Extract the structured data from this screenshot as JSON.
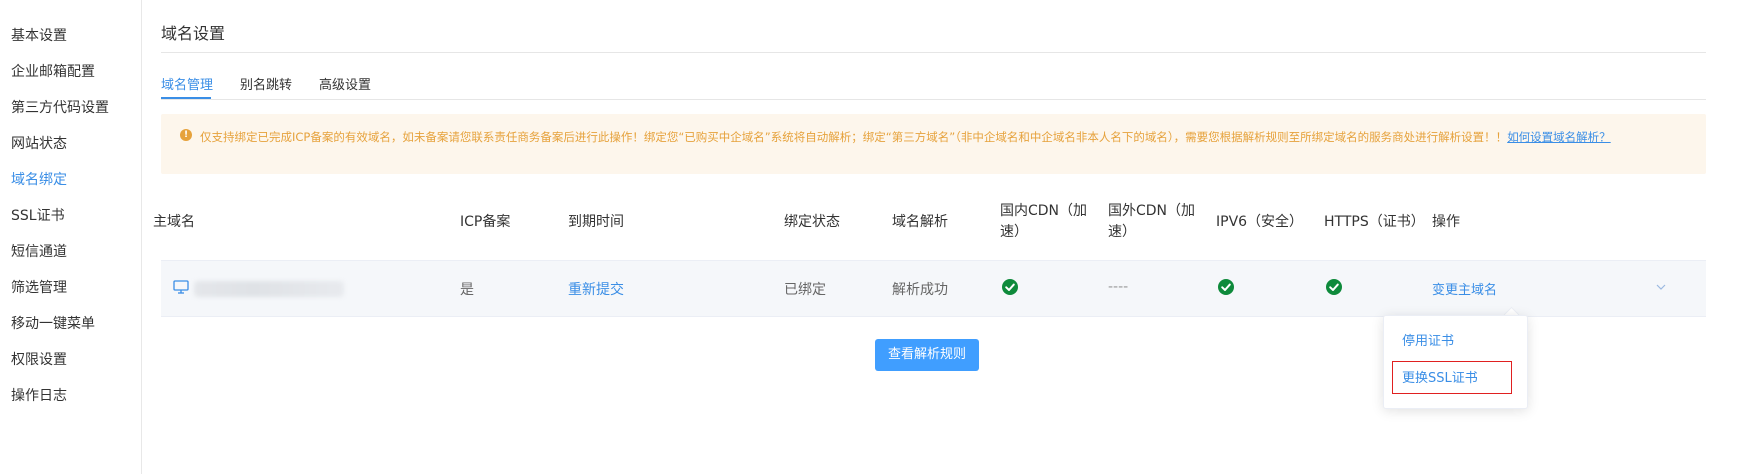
{
  "sidebar": {
    "items": [
      {
        "label": "基本设置"
      },
      {
        "label": "企业邮箱配置"
      },
      {
        "label": "第三方代码设置"
      },
      {
        "label": "网站状态"
      },
      {
        "label": "域名绑定"
      },
      {
        "label": "SSL证书"
      },
      {
        "label": "短信通道"
      },
      {
        "label": "筛选管理"
      },
      {
        "label": "移动一键菜单"
      },
      {
        "label": "权限设置"
      },
      {
        "label": "操作日志"
      }
    ],
    "active": "域名绑定"
  },
  "page": {
    "title": "域名设置"
  },
  "tabs": [
    {
      "label": "域名管理"
    },
    {
      "label": "别名跳转"
    },
    {
      "label": "高级设置"
    }
  ],
  "notice": {
    "icon": "warning-icon",
    "text": "仅支持绑定已完成ICP备案的有效域名，如未备案请您联系责任商务备案后进行此操作！绑定您“已购买中企域名”系统将自动解析；绑定“第三方域名”（非中企域名和中企域名非本人名下的域名），需要您根据解析规则至所绑定域名的服务商处进行解析设置！！",
    "link": "如何设置域名解析？",
    "color": "#e6a23c"
  },
  "table": {
    "headers": {
      "main_domain": "主域名",
      "icp": "ICP备案",
      "expire": "到期时间",
      "bind_status": "绑定状态",
      "dns": "域名解析",
      "cdn_domestic": "国内CDN（加速）",
      "cdn_foreign": "国外CDN（加速）",
      "ipv6": "IPV6（安全）",
      "https": "HTTPS（证书）",
      "actions": "操作"
    },
    "rows": [
      {
        "icp": "是",
        "expire_action": "重新提交",
        "bind_status": "已绑定",
        "dns": "解析成功",
        "cdn_foreign": "----",
        "action": "变更主域名"
      }
    ]
  },
  "buttons": {
    "view_rules": "查看解析规则"
  },
  "dropdown": {
    "items": [
      {
        "label": "停用证书"
      },
      {
        "label": "更换SSL证书"
      }
    ]
  },
  "colors": {
    "accent": "#3a8ee6",
    "primary_button": "#409eff",
    "success": "#0e8a3b",
    "warning": "#e6a23c",
    "highlight_border": "#e02020"
  }
}
